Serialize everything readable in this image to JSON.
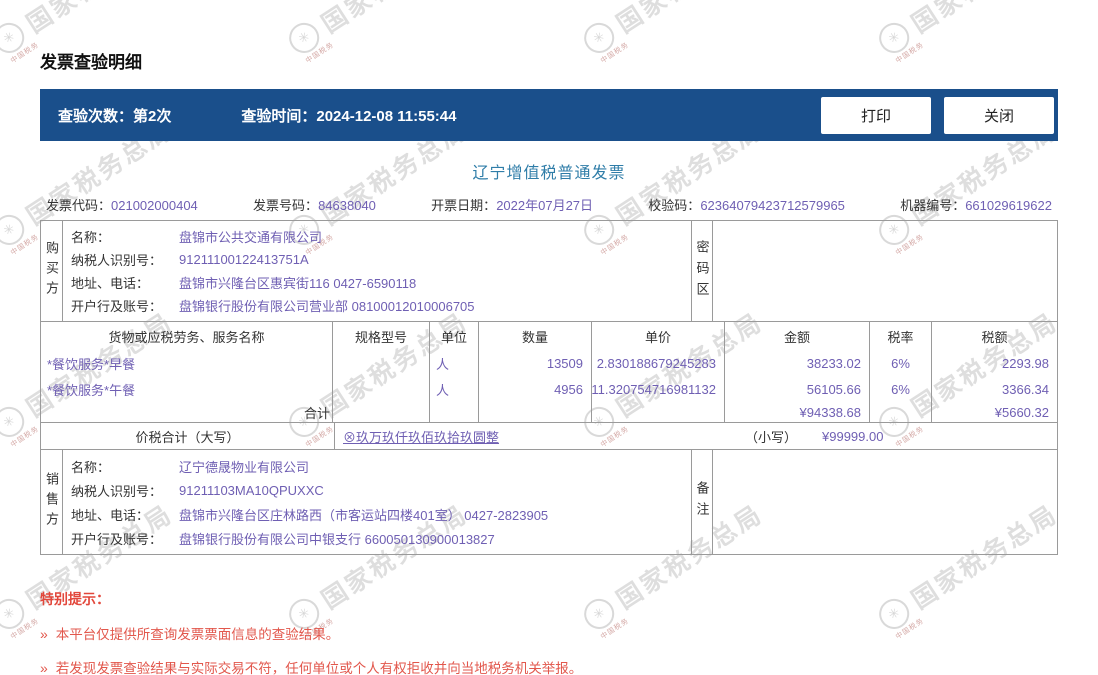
{
  "colors": {
    "header_bar": "#1A4F8B",
    "value_purple": "#6F5FB3",
    "invoice_title_teal": "#2F7DA8",
    "notice_red": "#E2574C",
    "table_border": "#9A9A9A"
  },
  "page": {
    "title": "发票查验明细",
    "watermark": {
      "text": "国家税务总局",
      "subtext": "中国税务"
    }
  },
  "toolbar": {
    "check_count_label": "查验次数：",
    "check_count_value": "第2次",
    "check_time_label": "查验时间：",
    "check_time_value": "2024-12-08 11:55:44",
    "print_label": "打印",
    "close_label": "关闭"
  },
  "invoice": {
    "title": "辽宁增值税普通发票",
    "meta": [
      {
        "label": "发票代码：",
        "value": "021002000404"
      },
      {
        "label": "发票号码：",
        "value": "84638040"
      },
      {
        "label": "开票日期：",
        "value": "2022年07月27日"
      },
      {
        "label": "校验码：",
        "value": "62364079423712579965"
      },
      {
        "label": "机器编号：",
        "value": "661029619622"
      }
    ],
    "buyer": {
      "side_label": "购买方",
      "password_area_label": "密码区",
      "rows": [
        {
          "label": "名称：",
          "value": "盘锦市公共交通有限公司"
        },
        {
          "label": "纳税人识别号：",
          "value": "91211100122413751A"
        },
        {
          "label": "地址、电话：",
          "value": "盘锦市兴隆台区惠宾街116 0427-6590118"
        },
        {
          "label": "开户行及账号：",
          "value": "盘锦银行股份有限公司营业部 08100012010006705"
        }
      ]
    },
    "items_table": {
      "headers": [
        "货物或应税劳务、服务名称",
        "规格型号",
        "单位",
        "数量",
        "单价",
        "金额",
        "税率",
        "税额"
      ],
      "rows": [
        {
          "name": "*餐饮服务*早餐",
          "spec": "",
          "unit": "人",
          "qty": "13509",
          "price": "2.830188679245283",
          "amount": "38233.02",
          "tax_rate": "6%",
          "tax": "2293.98"
        },
        {
          "name": "*餐饮服务*午餐",
          "spec": "",
          "unit": "人",
          "qty": "4956",
          "price": "11.320754716981132",
          "amount": "56105.66",
          "tax_rate": "6%",
          "tax": "3366.34"
        }
      ],
      "total": {
        "label": "合计",
        "amount": "¥94338.68",
        "tax": "¥5660.32"
      }
    },
    "total_line": {
      "label": "价税合计（大写）",
      "amount_in_words": "⊗玖万玖仟玖佰玖拾玖圆整",
      "small_label": "（小写）",
      "amount": "¥99999.00"
    },
    "seller": {
      "side_label": "销售方",
      "remarks_label": "备注",
      "rows": [
        {
          "label": "名称：",
          "value": "辽宁德晟物业有限公司"
        },
        {
          "label": "纳税人识别号：",
          "value": "91211103MA10QPUXXC"
        },
        {
          "label": "地址、电话：",
          "value": "盘锦市兴隆台区庄林路西（市客运站四楼401室） 0427-2823905"
        },
        {
          "label": "开户行及账号：",
          "value": "盘锦银行股份有限公司中银支行 660050130900013827"
        }
      ]
    }
  },
  "notices": {
    "title": "特别提示：",
    "bullet": "»",
    "items": [
      "本平台仅提供所查询发票票面信息的查验结果。",
      "若发现发票查验结果与实际交易不符，任何单位或个人有权拒收并向当地税务机关举报。"
    ]
  }
}
